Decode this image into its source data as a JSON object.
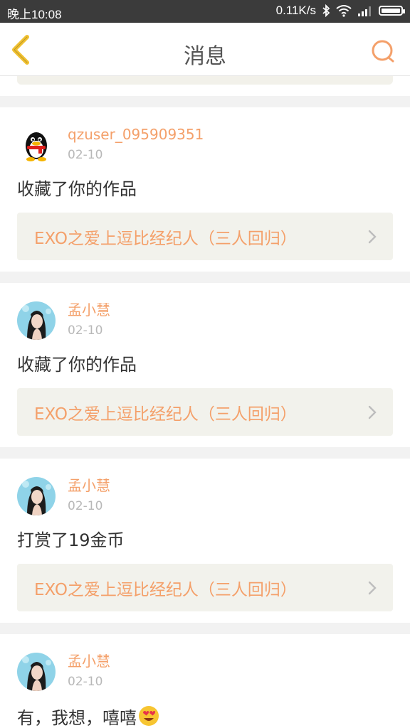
{
  "status_bar": {
    "time": "晚上10:08",
    "speed": "0.11K/s"
  },
  "header": {
    "title": "消息"
  },
  "colors": {
    "accent": "#f4a06a",
    "back_arrow": "#f0c030",
    "link_bg": "#f2f2ec"
  },
  "notifications": [
    {
      "username": "qzuser_095909351",
      "date": "02-10",
      "message": "收藏了你的作品",
      "work_title": "EXO之爱上逗比经纪人（三人回归）",
      "avatar": "qq-penguin-icon"
    },
    {
      "username": "孟小慧",
      "date": "02-10",
      "message": "收藏了你的作品",
      "work_title": "EXO之爱上逗比经纪人（三人回归）",
      "avatar": "photo-avatar"
    },
    {
      "username": "孟小慧",
      "date": "02-10",
      "message": "打赏了19金币",
      "work_title": "EXO之爱上逗比经纪人（三人回归）",
      "avatar": "photo-avatar"
    },
    {
      "username": "孟小慧",
      "date": "02-10",
      "message": "有，我想，嘻嘻",
      "avatar": "photo-avatar",
      "emoji": "heart-eyes-emoji-icon"
    }
  ]
}
